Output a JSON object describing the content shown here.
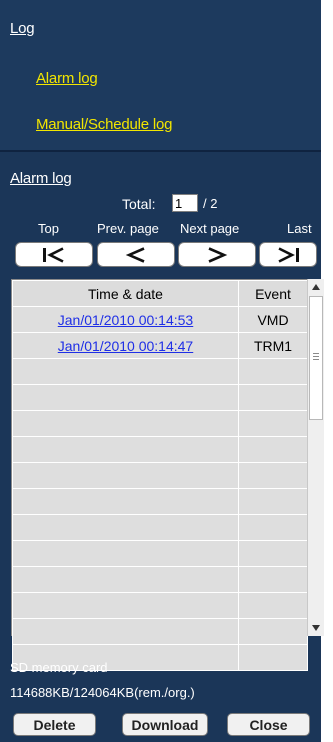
{
  "nav": {
    "heading": "Log",
    "links": [
      "Alarm log",
      "Manual/Schedule log"
    ]
  },
  "section": {
    "title": "Alarm log",
    "total_label": "Total:",
    "page_input_value": "1",
    "page_total": "/ 2"
  },
  "pager": {
    "labels": {
      "top": "Top",
      "prev": "Prev. page",
      "next": "Next page",
      "last": "Last"
    },
    "icons": [
      "first-page-icon",
      "prev-page-icon",
      "next-page-icon",
      "last-page-icon"
    ]
  },
  "table": {
    "headers": [
      "Time & date",
      "Event"
    ],
    "rows": [
      {
        "datetime": "Jan/01/2010 00:14:53",
        "event": "VMD"
      },
      {
        "datetime": "Jan/01/2010 00:14:47",
        "event": "TRM1"
      }
    ]
  },
  "sd_card": {
    "label": "SD memory card",
    "size": "114688KB/124064KB(rem./org.)"
  },
  "actions": {
    "delete": "Delete",
    "download": "Download",
    "close": "Close"
  },
  "colors": {
    "panel": "#1b3658",
    "link_yellow": "#f2e600",
    "link_blue": "#1f2fe6"
  }
}
